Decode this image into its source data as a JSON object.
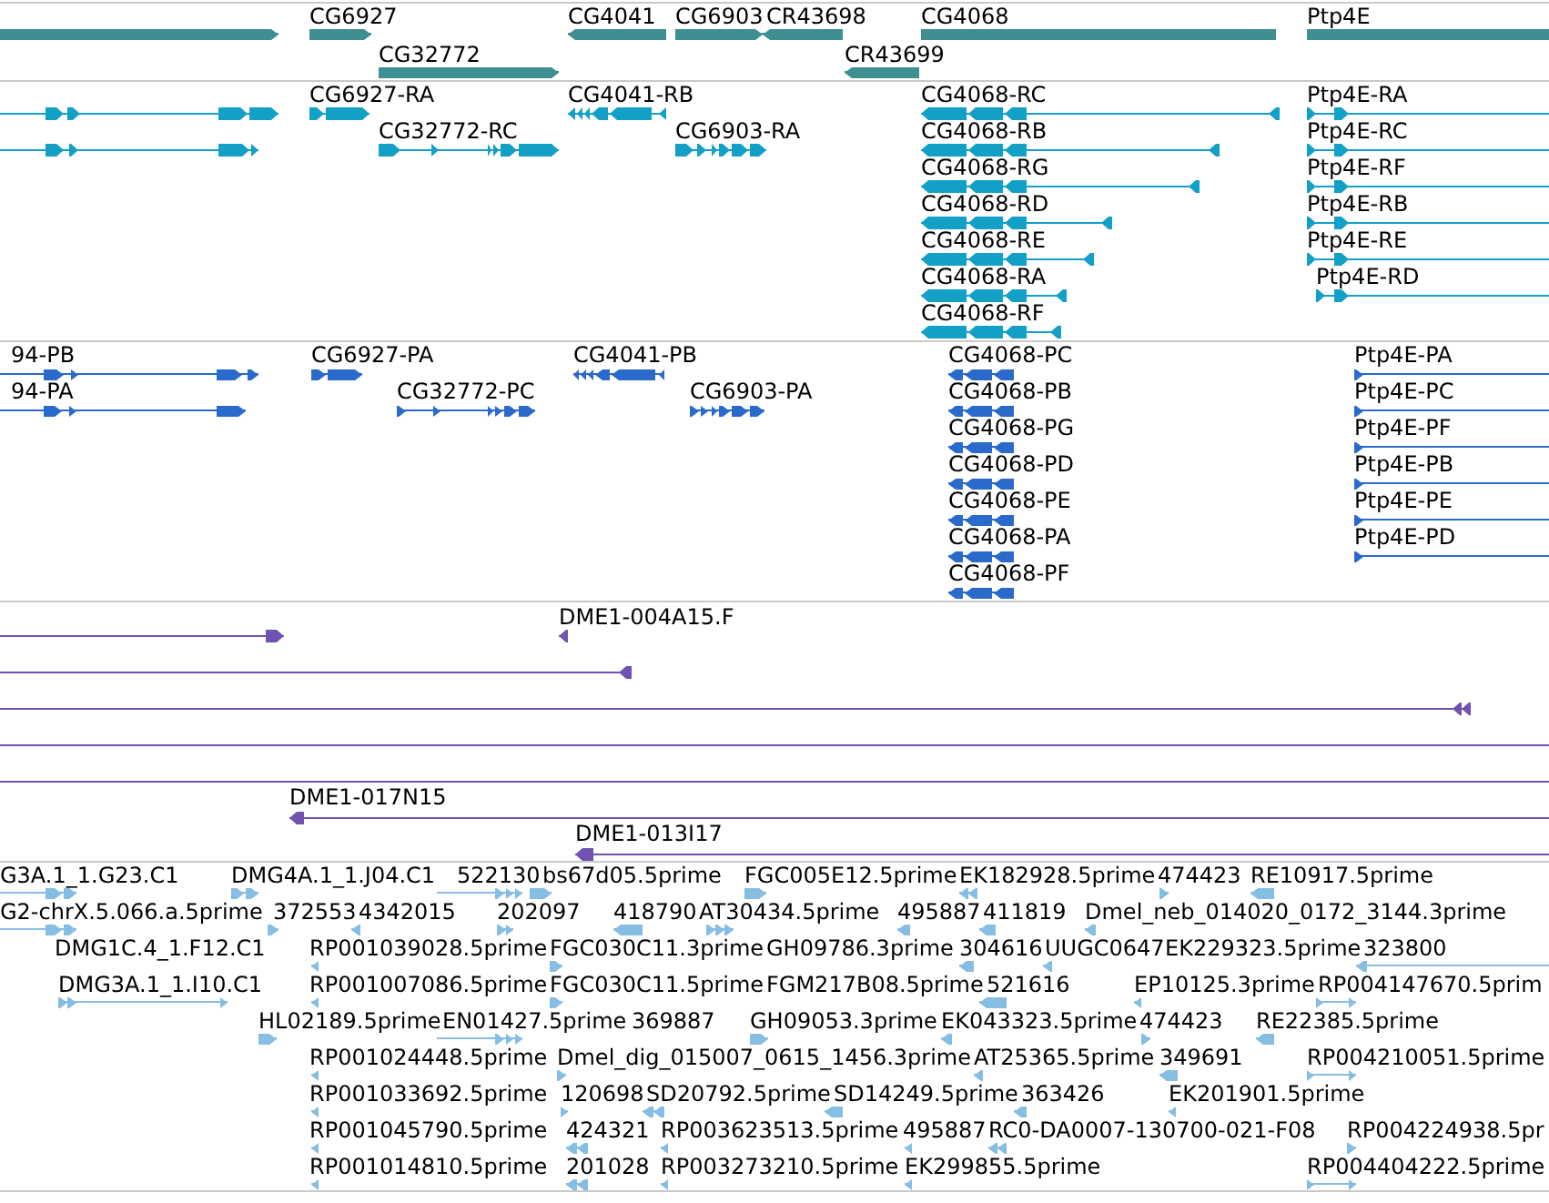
{
  "tracks": [
    {
      "kind": "gene",
      "features": [
        {
          "reverse": false
        },
        {
          "label": "CG6927",
          "reverse": false
        },
        {
          "label": "CG4041",
          "reverse": true
        },
        {
          "label": "CG6903",
          "reverse": false
        },
        {
          "label": "CR43698",
          "reverse": true
        },
        {
          "label": "CG4068"
        },
        {
          "label": "Ptp4E",
          "reverse": false
        },
        {
          "label": "CG32772",
          "reverse": false
        },
        {
          "label": "CR43699",
          "reverse": true
        }
      ]
    },
    {
      "kind": "transcript",
      "features": [
        {
          "reverse": false
        },
        {
          "label": "CG6927-RA",
          "reverse": false
        },
        {
          "label": "CG4041-RB",
          "reverse": true
        },
        {
          "label": "CG4068-RC",
          "reverse": true
        },
        {
          "label": "Ptp4E-RA",
          "reverse": false
        },
        {
          "reverse": false
        },
        {
          "label": "CG32772-RC",
          "reverse": false
        },
        {
          "label": "CG6903-RA",
          "reverse": false
        },
        {
          "label": "CG4068-RB",
          "reverse": true
        },
        {
          "label": "Ptp4E-RC",
          "reverse": false
        },
        {
          "label": "CG4068-RG",
          "reverse": true
        },
        {
          "label": "Ptp4E-RF",
          "reverse": false
        },
        {
          "label": "CG4068-RD",
          "reverse": true
        },
        {
          "label": "Ptp4E-RB",
          "reverse": false
        },
        {
          "label": "CG4068-RE",
          "reverse": true
        },
        {
          "label": "Ptp4E-RE",
          "reverse": false
        },
        {
          "label": "CG4068-RA",
          "reverse": true
        },
        {
          "label": "Ptp4E-RD",
          "reverse": false
        },
        {
          "label": "CG4068-RF",
          "reverse": true
        }
      ]
    },
    {
      "kind": "protein",
      "features": [
        {
          "label": "94-PB",
          "reverse": false
        },
        {
          "label": "CG6927-PA",
          "reverse": false
        },
        {
          "label": "CG4041-PB",
          "reverse": true
        },
        {
          "label": "CG4068-PC",
          "reverse": true
        },
        {
          "label": "Ptp4E-PA",
          "reverse": false
        },
        {
          "label": "94-PA",
          "reverse": false
        },
        {
          "label": "CG32772-PC",
          "reverse": false
        },
        {
          "label": "CG6903-PA",
          "reverse": false
        },
        {
          "label": "CG4068-PB",
          "reverse": true
        },
        {
          "label": "Ptp4E-PC",
          "reverse": false
        },
        {
          "label": "CG4068-PG",
          "reverse": true
        },
        {
          "label": "Ptp4E-PF",
          "reverse": false
        },
        {
          "label": "CG4068-PD",
          "reverse": true
        },
        {
          "label": "Ptp4E-PB",
          "reverse": false
        },
        {
          "label": "CG4068-PE",
          "reverse": true
        },
        {
          "label": "Ptp4E-PE",
          "reverse": false
        },
        {
          "label": "CG4068-PA",
          "reverse": true
        },
        {
          "label": "Ptp4E-PD",
          "reverse": false
        },
        {
          "label": "CG4068-PF",
          "reverse": true
        }
      ]
    },
    {
      "kind": "clone",
      "features": [
        {
          "reverse": false
        },
        {
          "label": "DME1-004A15.F",
          "reverse": true
        },
        {
          "reverse": true
        },
        {
          "reverse": true
        },
        {
          "label": "DME1-017N15",
          "reverse": true
        },
        {
          "label": "DME1-013I17",
          "reverse": true
        }
      ]
    },
    {
      "kind": "est",
      "features": [
        {
          "label": "G3A.1_1.G23.C1",
          "reverse": false
        },
        {
          "label": "DMG4A.1_1.J04.C1",
          "reverse": false
        },
        {
          "label": "522130",
          "reverse": false
        },
        {
          "label": "bs67d05.5prime",
          "reverse": false
        },
        {
          "label": "FGC005E12.5prime",
          "reverse": false
        },
        {
          "label": "EK182928.5prime",
          "reverse": true
        },
        {
          "label": "474423",
          "reverse": false
        },
        {
          "label": "RE10917.5prime",
          "reverse": true
        },
        {
          "label": "G2-chrX.5.066.a.5prime",
          "reverse": false
        },
        {
          "label": "372553",
          "reverse": false
        },
        {
          "label": "4342015",
          "reverse": true
        },
        {
          "label": "202097",
          "reverse": false
        },
        {
          "label": "418790",
          "reverse": true
        },
        {
          "label": "AT30434.5prime",
          "reverse": false
        },
        {
          "label": "495887",
          "reverse": true
        },
        {
          "label": "411819",
          "reverse": true
        },
        {
          "label": "Dmel_neb_014020_0172_3144.3prime",
          "reverse": true
        },
        {
          "label": "DMG1C.4_1.F12.C1"
        },
        {
          "label": "RP001039028.5prime",
          "reverse": true
        },
        {
          "label": "FGC030C11.3prime",
          "reverse": false
        },
        {
          "label": "GH09786.3prime"
        },
        {
          "label": "304616",
          "reverse": true
        },
        {
          "label": "UUGC0647",
          "reverse": true
        },
        {
          "label": "EK229323.5prime"
        },
        {
          "label": "323800",
          "reverse": true
        },
        {
          "label": "DMG3A.1_1.I10.C1",
          "reverse": false
        },
        {
          "label": "RP001007086.5prime",
          "reverse": true
        },
        {
          "label": "FGC030C11.5prime",
          "reverse": false
        },
        {
          "label": "FGM217B08.5prime"
        },
        {
          "label": "521616",
          "reverse": true
        },
        {
          "label": "EP10125.3prime",
          "reverse": true
        },
        {
          "label": "RP004147670.5prim",
          "reverse": false
        },
        {
          "label": "HL02189.5prime",
          "reverse": false
        },
        {
          "label": "EN01427.5prime",
          "reverse": false
        },
        {
          "label": "369887"
        },
        {
          "label": "GH09053.3prime",
          "reverse": false
        },
        {
          "label": "EK043323.5prime",
          "reverse": true
        },
        {
          "label": "474423",
          "reverse": false
        },
        {
          "label": "RE22385.5prime",
          "reverse": true
        },
        {
          "label": "RP001024448.5prime",
          "reverse": true
        },
        {
          "label": "Dmel_dig_015007_0615_1456.3prime",
          "reverse": false
        },
        {
          "label": "AT25365.5prime",
          "reverse": true
        },
        {
          "label": "349691",
          "reverse": true
        },
        {
          "label": "RP004210051.5prime",
          "reverse": false
        },
        {
          "label": "RP001033692.5prime",
          "reverse": true
        },
        {
          "label": "120698",
          "reverse": false
        },
        {
          "label": "SD20792.5prime",
          "reverse": true
        },
        {
          "label": "SD14249.5prime",
          "reverse": true
        },
        {
          "label": "363426",
          "reverse": true
        },
        {
          "label": "EK201901.5prime",
          "reverse": true
        },
        {
          "label": "RP001045790.5prime",
          "reverse": true
        },
        {
          "label": "424321",
          "reverse": true
        },
        {
          "label": "RP003623513.5prime",
          "reverse": true
        },
        {
          "label": "495887",
          "reverse": true
        },
        {
          "label": "RC0-DA0007-130700-021-F08",
          "reverse": true
        },
        {
          "label": "RP004224938.5pr",
          "reverse": false
        },
        {
          "label": "RP001014810.5prime",
          "reverse": true
        },
        {
          "label": "201028",
          "reverse": true
        },
        {
          "label": "RP003273210.5prime",
          "reverse": true
        },
        {
          "label": "EK299855.5prime",
          "reverse": true
        },
        {
          "label": "RP004404222.5prime",
          "reverse": false
        }
      ]
    }
  ]
}
